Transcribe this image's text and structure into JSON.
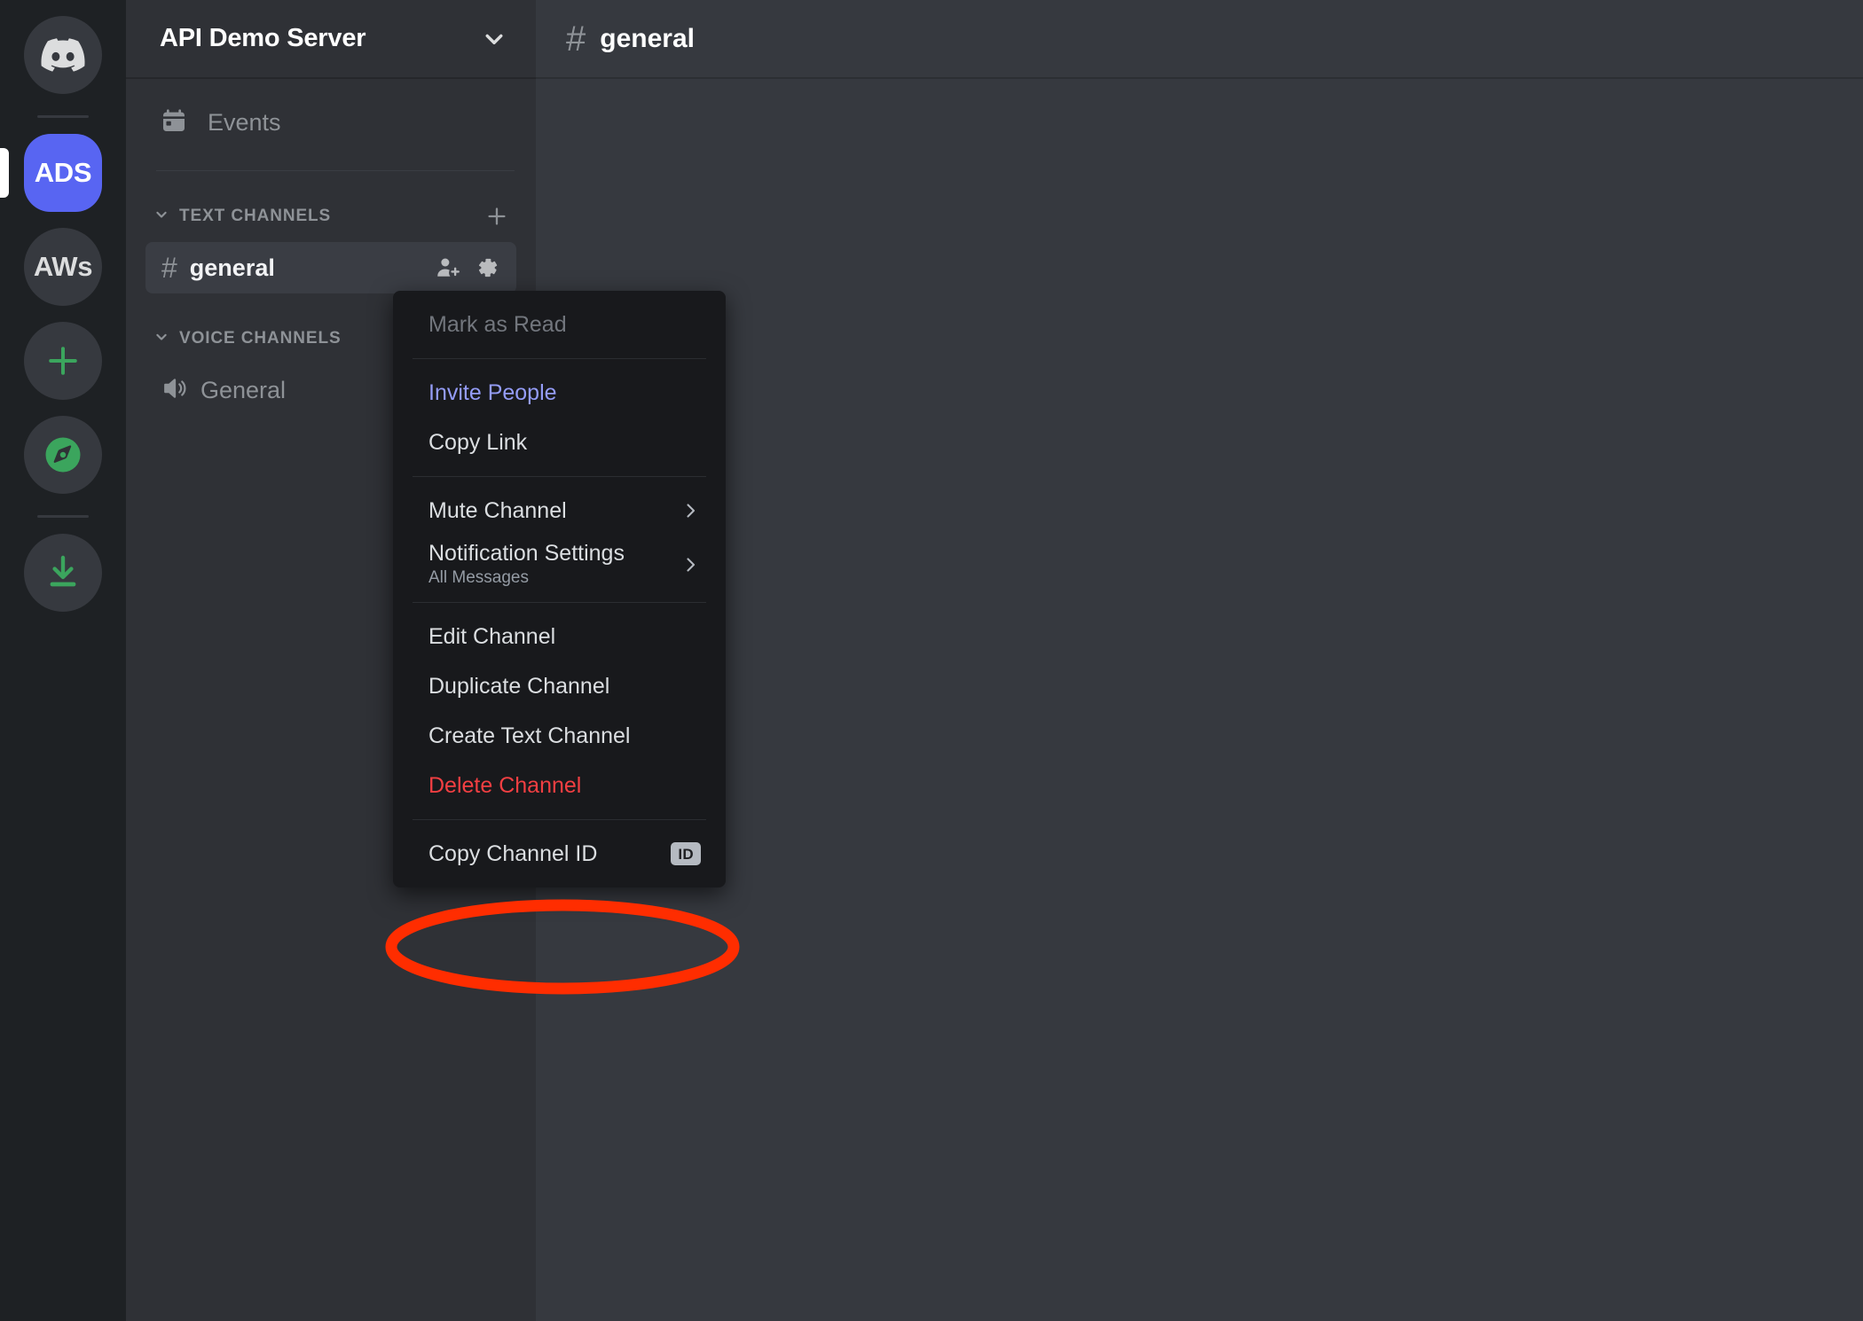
{
  "server_rail": {
    "items": [
      {
        "name": "discord-home",
        "label": "",
        "icon": "discord-logo-icon",
        "active": false,
        "type": "logo"
      },
      {
        "name": "server-ads",
        "label": "ADS",
        "icon": "server-avatar",
        "active": true,
        "type": "server"
      },
      {
        "name": "server-aws",
        "label": "AWs",
        "icon": "server-avatar",
        "active": false,
        "type": "server"
      },
      {
        "name": "add-server",
        "label": "",
        "icon": "plus-icon",
        "active": false,
        "type": "action"
      },
      {
        "name": "explore-servers",
        "label": "",
        "icon": "compass-icon",
        "active": false,
        "type": "action"
      },
      {
        "name": "download-apps",
        "label": "",
        "icon": "download-icon",
        "active": false,
        "type": "action"
      }
    ]
  },
  "sidebar": {
    "server_name": "API Demo Server",
    "nav": [
      {
        "label": "Events",
        "icon": "calendar-icon"
      }
    ],
    "categories": [
      {
        "name": "TEXT CHANNELS",
        "has_add": true,
        "channels": [
          {
            "name": "general",
            "icon": "hash-icon",
            "selected": true,
            "actions": [
              "person-add-icon",
              "gear-icon"
            ]
          }
        ]
      },
      {
        "name": "VOICE CHANNELS",
        "has_add": false,
        "channels": [
          {
            "name": "General",
            "icon": "speaker-icon",
            "selected": false,
            "actions": []
          }
        ]
      }
    ]
  },
  "main": {
    "channel_hash": "#",
    "channel_title": "general"
  },
  "context_menu": {
    "groups": [
      {
        "items": [
          {
            "label": "Mark as Read",
            "style": "disabled",
            "submenu": false,
            "badge": null,
            "sub": null
          }
        ]
      },
      {
        "items": [
          {
            "label": "Invite People",
            "style": "invite",
            "submenu": false,
            "badge": null,
            "sub": null
          },
          {
            "label": "Copy Link",
            "style": "normal",
            "submenu": false,
            "badge": null,
            "sub": null
          }
        ]
      },
      {
        "items": [
          {
            "label": "Mute Channel",
            "style": "normal",
            "submenu": true,
            "badge": null,
            "sub": null
          },
          {
            "label": "Notification Settings",
            "style": "normal",
            "submenu": true,
            "badge": null,
            "sub": "All Messages"
          }
        ]
      },
      {
        "items": [
          {
            "label": "Edit Channel",
            "style": "normal",
            "submenu": false,
            "badge": null,
            "sub": null
          },
          {
            "label": "Duplicate Channel",
            "style": "normal",
            "submenu": false,
            "badge": null,
            "sub": null
          },
          {
            "label": "Create Text Channel",
            "style": "normal",
            "submenu": false,
            "badge": null,
            "sub": null
          },
          {
            "label": "Delete Channel",
            "style": "danger",
            "submenu": false,
            "badge": null,
            "sub": null
          }
        ]
      },
      {
        "items": [
          {
            "label": "Copy Channel ID",
            "style": "normal",
            "submenu": false,
            "badge": "ID",
            "sub": null
          }
        ]
      }
    ]
  },
  "annotation": {
    "shape": "ellipse",
    "color": "#ff2d00",
    "target": "Copy Channel ID"
  },
  "colors": {
    "accent_blurple": "#5865f2",
    "invite_link": "#949cf7",
    "danger_red": "#f23f42",
    "green_action": "#3ba55d",
    "sidebar_bg": "#2f3136",
    "rail_bg": "#1e2124",
    "main_bg": "#36393f",
    "menu_bg": "#18191c",
    "annotation_red": "#ff2d00"
  }
}
